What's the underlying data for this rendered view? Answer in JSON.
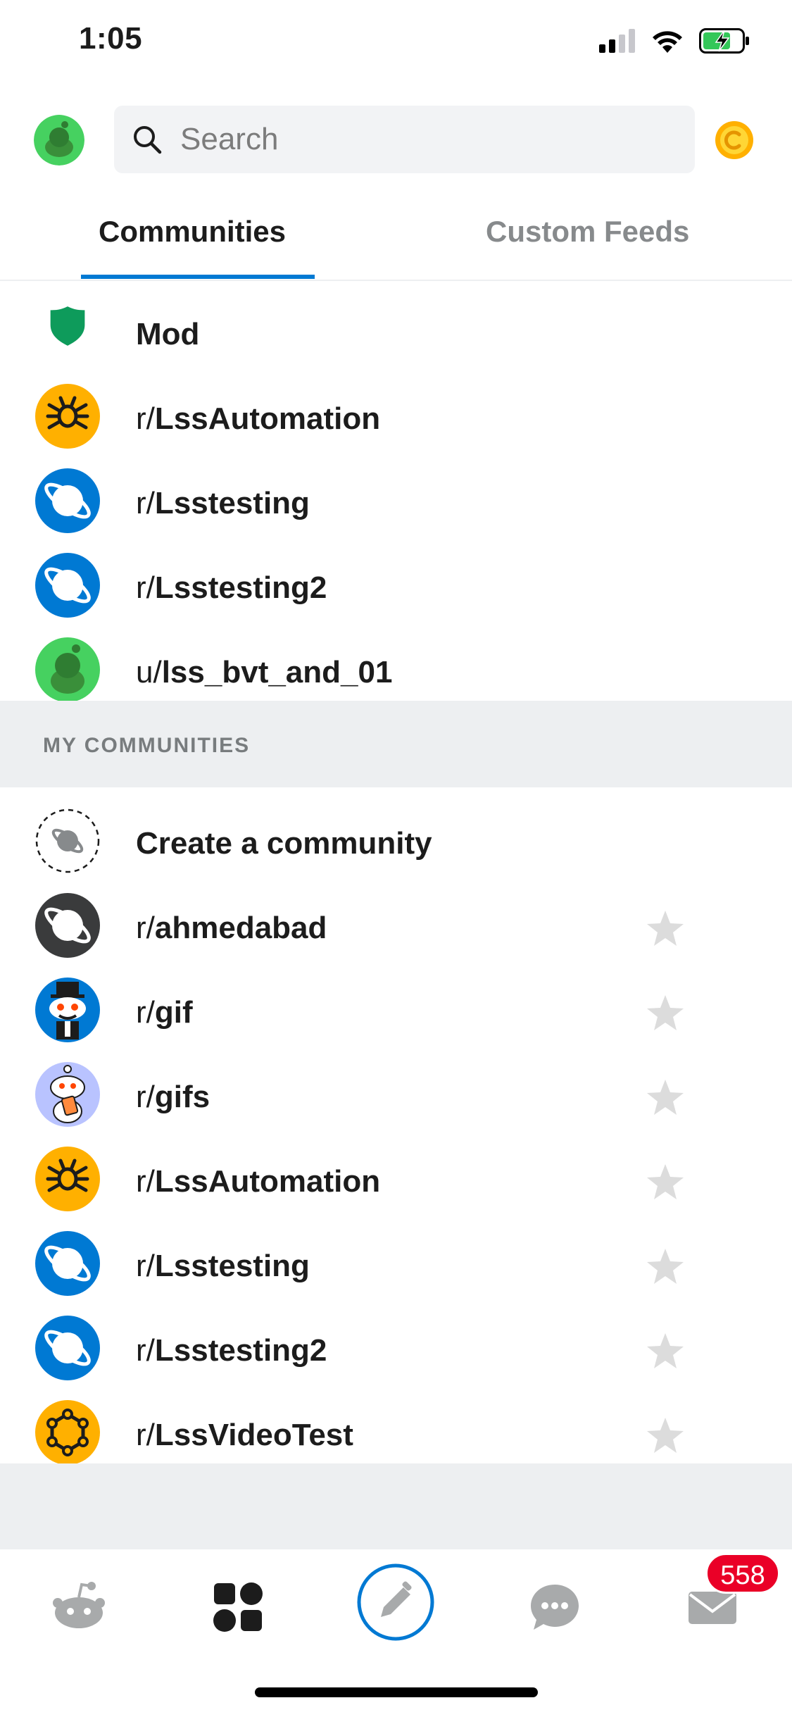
{
  "status_bar": {
    "time": "1:05"
  },
  "header": {
    "search_placeholder": "Search"
  },
  "tabs": {
    "communities": "Communities",
    "custom_feeds": "Custom Feeds"
  },
  "top_list": [
    {
      "prefix": "",
      "name": "Mod",
      "icon": "shield-icon"
    },
    {
      "prefix": "r/",
      "name": "LssAutomation",
      "icon": "bug-icon"
    },
    {
      "prefix": "r/",
      "name": "Lsstesting",
      "icon": "planet-icon"
    },
    {
      "prefix": "r/",
      "name": "Lsstesting2",
      "icon": "planet-icon"
    },
    {
      "prefix": "u/",
      "name": "lss_bvt_and_01",
      "icon": "snoo-avatar-icon"
    }
  ],
  "section": {
    "title": "MY COMMUNITIES"
  },
  "create_community": {
    "label": "Create a community"
  },
  "my_communities": [
    {
      "prefix": "r/",
      "name": "ahmedabad"
    },
    {
      "prefix": "r/",
      "name": "gif"
    },
    {
      "prefix": "r/",
      "name": "gifs"
    },
    {
      "prefix": "r/",
      "name": "LssAutomation"
    },
    {
      "prefix": "r/",
      "name": "Lsstesting"
    },
    {
      "prefix": "r/",
      "name": "Lsstesting2"
    },
    {
      "prefix": "r/",
      "name": "LssVideoTest"
    }
  ],
  "tab_bar": {
    "inbox_badge": "558"
  },
  "colors": {
    "accent": "#0079d3",
    "badge": "#ea0027",
    "mod_green": "#0dd3bb"
  }
}
